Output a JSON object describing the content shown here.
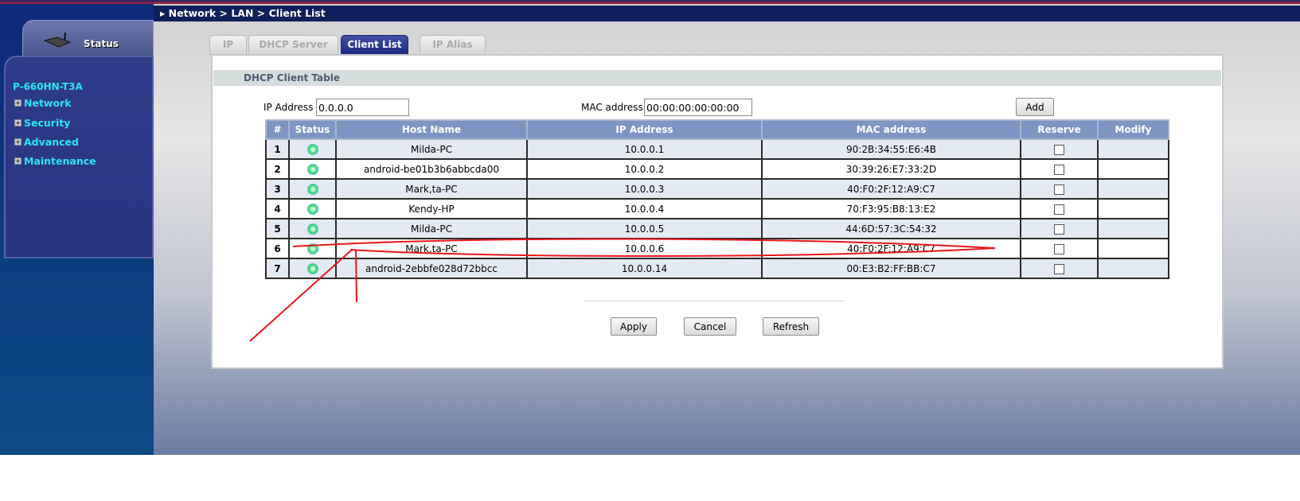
{
  "breadcrumb": "Network > LAN > Client List",
  "sidebar": {
    "status_label": "Status",
    "model": "P-660HN-T3A",
    "items": [
      {
        "label": "Network"
      },
      {
        "label": "Security"
      },
      {
        "label": "Advanced"
      },
      {
        "label": "Maintenance"
      }
    ]
  },
  "tabs": [
    {
      "label": "IP"
    },
    {
      "label": "DHCP Server"
    },
    {
      "label": "Client List",
      "active": true
    },
    {
      "label": "IP Alias"
    }
  ],
  "section_title": "DHCP Client Table",
  "form": {
    "ip_label": "IP Address",
    "ip_value": "0.0.0.0",
    "mac_label": "MAC address",
    "mac_value": "00:00:00:00:00:00",
    "add_label": "Add"
  },
  "table": {
    "headers": [
      "#",
      "Status",
      "Host Name",
      "IP Address",
      "MAC address",
      "Reserve",
      "Modify"
    ],
    "rows": [
      {
        "num": "1",
        "host": "Milda-PC",
        "ip": "10.0.0.1",
        "mac": "90:2B:34:55:E6:4B",
        "reserve": false
      },
      {
        "num": "2",
        "host": "android-be01b3b6abbcda00",
        "ip": "10.0.0.2",
        "mac": "30:39:26:E7:33:2D",
        "reserve": false
      },
      {
        "num": "3",
        "host": "Mark,ta-PC",
        "ip": "10.0.0.3",
        "mac": "40:F0:2F:12:A9:C7",
        "reserve": false
      },
      {
        "num": "4",
        "host": "Kendy-HP",
        "ip": "10.0.0.4",
        "mac": "70:F3:95:B8:13:E2",
        "reserve": false
      },
      {
        "num": "5",
        "host": "Milda-PC",
        "ip": "10.0.0.5",
        "mac": "44:6D:57:3C:54:32",
        "reserve": false
      },
      {
        "num": "6",
        "host": "Mark,ta-PC",
        "ip": "10.0.0.6",
        "mac": "40:F0:2F:12:A9:C7",
        "reserve": false
      },
      {
        "num": "7",
        "host": "android-2ebbfe028d72bbcc",
        "ip": "10.0.0.14",
        "mac": "00:E3:B2:FF:BB:C7",
        "reserve": false
      }
    ]
  },
  "buttons": {
    "apply": "Apply",
    "cancel": "Cancel",
    "refresh": "Refresh"
  },
  "annotation_color": "#e8151b"
}
